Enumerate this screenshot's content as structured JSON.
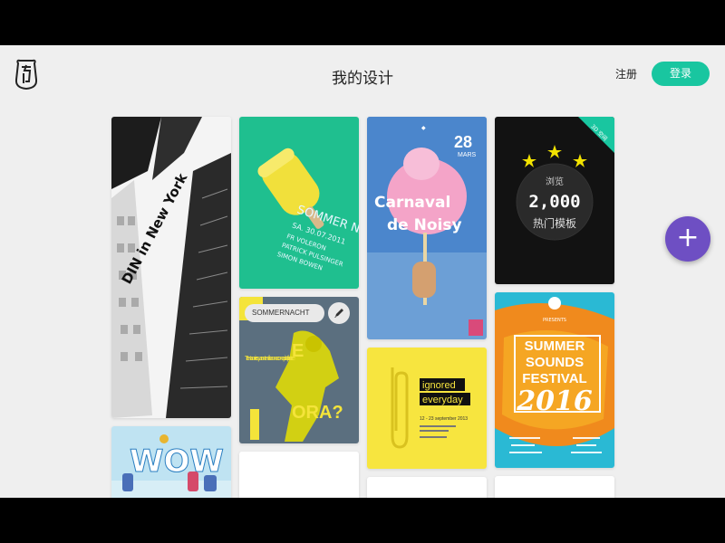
{
  "header": {
    "title": "我的设计",
    "register_label": "注册",
    "login_label": "登录",
    "login_color": "#19c6a0"
  },
  "fab": {
    "label": "+",
    "color": "#6e4fc3"
  },
  "templates": {
    "din": {
      "title": "DIN in New York"
    },
    "summer": {
      "title": "SOMMER NACHT",
      "date": "SA. 30.07.2011",
      "lines": [
        "FR VOLERON",
        "PATRICK PULSINGER",
        "SIMON BOWEN"
      ]
    },
    "carnaval": {
      "title_1": "Carnaval",
      "title_2": "de Noisy",
      "day": "28",
      "month": "MARS"
    },
    "promo": {
      "badge": "3D 空间",
      "label": "浏览",
      "count": "2,000",
      "subtitle": "热门模板"
    },
    "editing": {
      "name_value": "SOMMERNACHT",
      "body_text": "Trentanni e quarantenni hanno conquistato il potere",
      "big_1": "E",
      "big_2": "ORA?"
    },
    "ignored": {
      "line_1": "ignored",
      "line_2": "everyday",
      "date": "12 - 23 september 2013"
    },
    "festival": {
      "line_1": "SUMMER",
      "line_2": "SOUNDS",
      "line_3": "FESTIVAL",
      "year": "2016"
    },
    "wow": {
      "text": "WOW"
    }
  }
}
